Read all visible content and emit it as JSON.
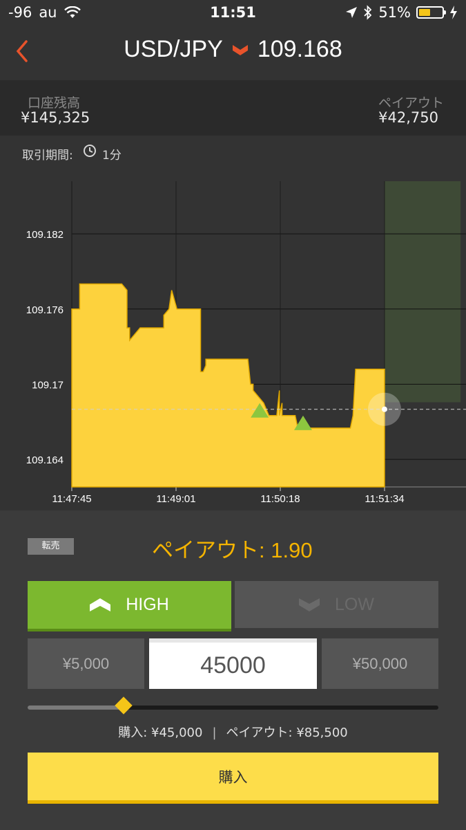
{
  "status_bar": {
    "signal": "-96",
    "carrier": "au",
    "time": "11:51",
    "battery_percent": "51%",
    "battery_level": 0.51
  },
  "header": {
    "pair": "USD/JPY",
    "price": "109.168",
    "direction_icon": "down-chevron-icon",
    "accent_color": "#e8532b"
  },
  "balance": {
    "account_label": "口座残高",
    "account_value": "¥145,325",
    "payout_label": "ペイアウト",
    "payout_value": "¥42,750"
  },
  "period": {
    "label": "取引期間:",
    "icon": "clock-icon",
    "value": "1分"
  },
  "chart_data": {
    "type": "area",
    "color": "#fdd23d",
    "x_tick_labels": [
      "11:47:45",
      "11:49:01",
      "11:50:18",
      "11:51:34"
    ],
    "y_tick_labels": [
      "109.182",
      "109.176",
      "109.17",
      "109.164"
    ],
    "ylim": [
      109.1618,
      109.1862
    ],
    "xlim_seconds_from_start": [
      0,
      300
    ],
    "series": [
      {
        "x_seconds": [
          0,
          6,
          6,
          38,
          42,
          42,
          44,
          44,
          52,
          52,
          70,
          70,
          74,
          76,
          80,
          82,
          82,
          98,
          98,
          100,
          100,
          102,
          102,
          108,
          108,
          112,
          114,
          134,
          136,
          138,
          138,
          146,
          150,
          150,
          156,
          158,
          158,
          160,
          160,
          170,
          172,
          188,
          188,
          190,
          190,
          192,
          196,
          198,
          200,
          200,
          212,
          214,
          216,
          218,
          218,
          232,
          234,
          238,
          238
        ],
        "y": [
          109.176,
          109.176,
          109.178,
          109.178,
          109.1775,
          109.1745,
          109.1745,
          109.1735,
          109.1745,
          109.1745,
          109.1745,
          109.1755,
          109.176,
          109.1775,
          109.176,
          109.176,
          109.176,
          109.176,
          109.171,
          109.171,
          109.171,
          109.1715,
          109.172,
          109.172,
          109.172,
          109.172,
          109.172,
          109.172,
          109.17,
          109.17,
          109.1695,
          109.1685,
          109.1675,
          109.1675,
          109.1675,
          109.1695,
          109.1675,
          109.1685,
          109.1675,
          109.1675,
          109.1665,
          109.1665,
          109.1665,
          109.1665,
          109.1665,
          109.1665,
          109.1665,
          109.1665,
          109.1665,
          109.1665,
          109.1665,
          109.1675,
          109.1712,
          109.1712,
          109.1712,
          109.1712,
          109.1712,
          109.1712,
          109.1712
        ]
      }
    ],
    "current_value": 109.168,
    "current_x_seconds": 238,
    "markers": [
      {
        "type": "high-entry",
        "x_seconds": 143,
        "y": 109.1675
      },
      {
        "type": "high-entry",
        "x_seconds": 176,
        "y": 109.1665
      }
    ],
    "expiry_zone_x_seconds": [
      238,
      300
    ],
    "grid": true
  },
  "controls": {
    "resell_label": "転売",
    "payout_rate_label": "ペイアウト: 1.90",
    "high_label": "HIGH",
    "low_label": "LOW",
    "preset_min": "¥5,000",
    "preset_max": "¥50,000",
    "amount_value": "45000",
    "slider_fraction": 0.233,
    "summary_buy": "購入: ¥45,000",
    "summary_separator": "|",
    "summary_payout": "ペイアウト: ¥85,500",
    "buy_label": "購入",
    "colors": {
      "high": "#7cb82f",
      "buy": "#fddd4a",
      "payout_rate": "#f5b400"
    }
  }
}
